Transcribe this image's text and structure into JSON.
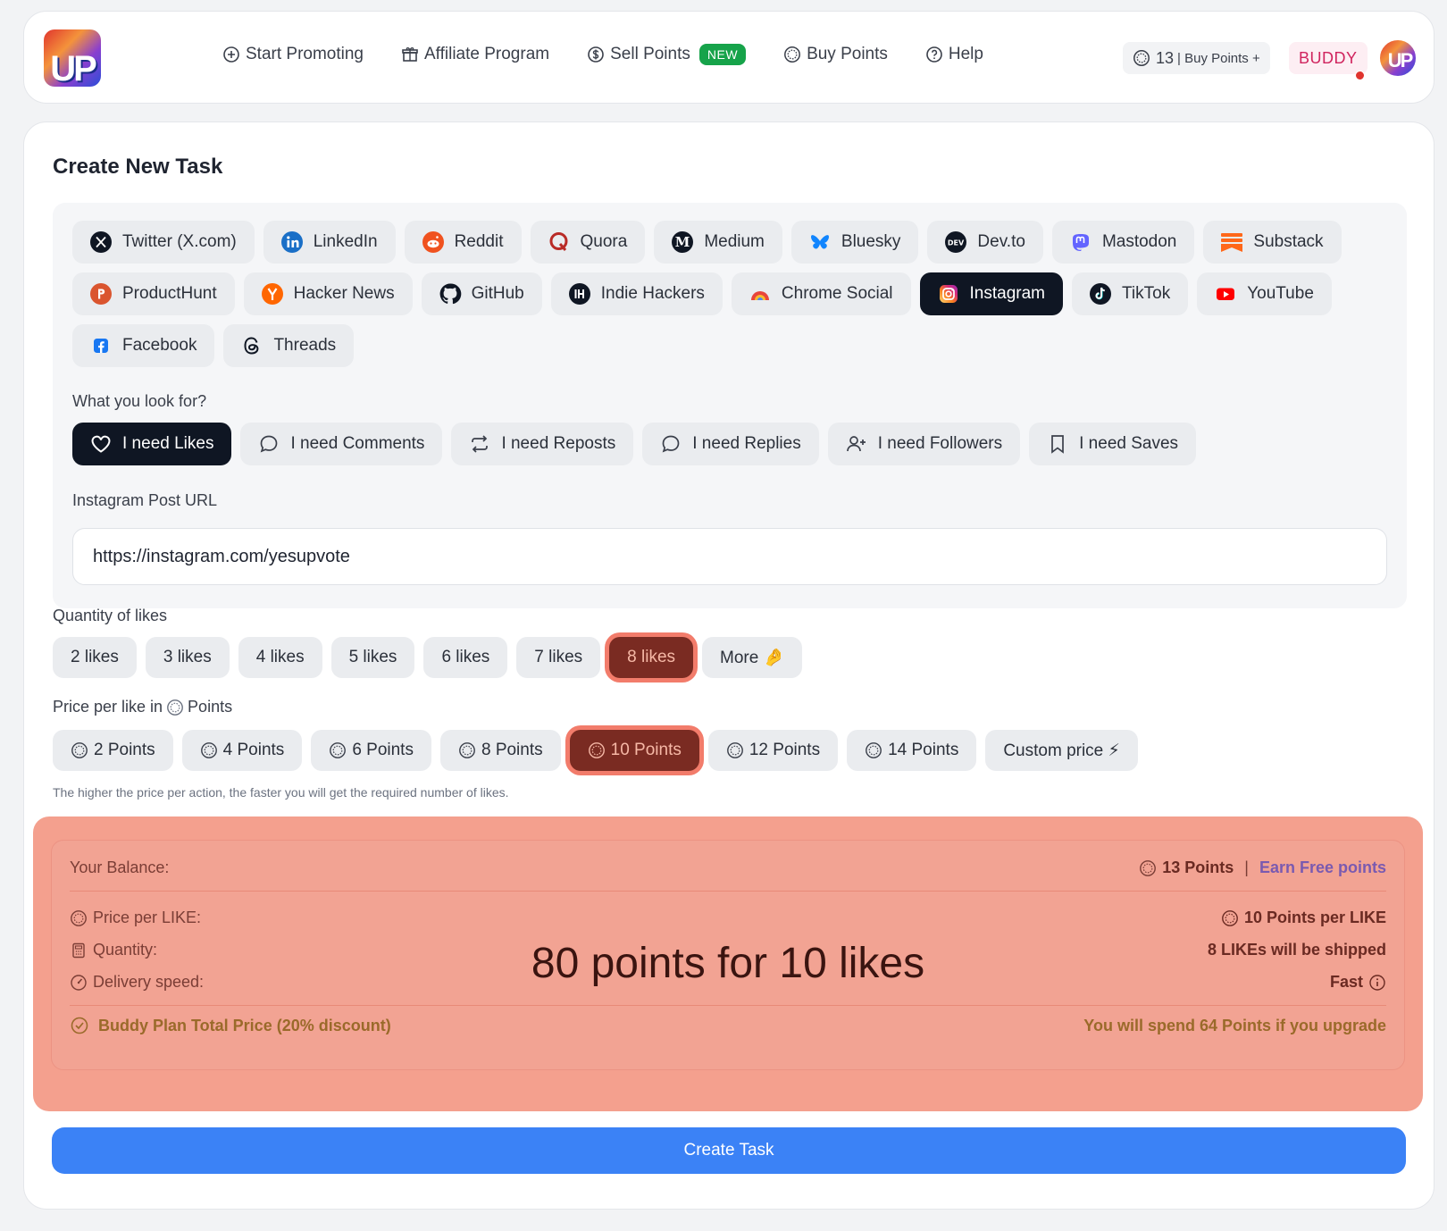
{
  "header": {
    "logo_text": "UP",
    "nav": [
      {
        "label": "Start Promoting",
        "icon": "plus-circle-icon"
      },
      {
        "label": "Affiliate Program",
        "icon": "gift-icon"
      },
      {
        "label": "Sell Points",
        "icon": "dollar-circle-icon",
        "badge": "NEW"
      },
      {
        "label": "Buy Points",
        "icon": "points-coin-icon"
      },
      {
        "label": "Help",
        "icon": "help-circle-icon"
      }
    ],
    "balance_count": "13",
    "balance_link": "| Buy Points +",
    "plan": "BUDDY"
  },
  "card": {
    "title": "Create New Task"
  },
  "platforms": [
    {
      "label": "Twitter (X.com)",
      "icon": "x-logo-icon"
    },
    {
      "label": "LinkedIn",
      "icon": "linkedin-icon"
    },
    {
      "label": "Reddit",
      "icon": "reddit-icon"
    },
    {
      "label": "Quora",
      "icon": "quora-icon"
    },
    {
      "label": "Medium",
      "icon": "medium-icon"
    },
    {
      "label": "Bluesky",
      "icon": "bluesky-icon"
    },
    {
      "label": "Dev.to",
      "icon": "devto-icon"
    },
    {
      "label": "Mastodon",
      "icon": "mastodon-icon"
    },
    {
      "label": "Substack",
      "icon": "substack-icon"
    },
    {
      "label": "ProductHunt",
      "icon": "producthunt-icon"
    },
    {
      "label": "Hacker News",
      "icon": "hackernews-icon"
    },
    {
      "label": "GitHub",
      "icon": "github-icon"
    },
    {
      "label": "Indie Hackers",
      "icon": "indiehackers-icon"
    },
    {
      "label": "Chrome Social",
      "icon": "chrome-icon"
    },
    {
      "label": "Instagram",
      "icon": "instagram-icon",
      "active": true
    },
    {
      "label": "TikTok",
      "icon": "tiktok-icon"
    },
    {
      "label": "YouTube",
      "icon": "youtube-icon"
    },
    {
      "label": "Facebook",
      "icon": "facebook-icon"
    },
    {
      "label": "Threads",
      "icon": "threads-icon"
    }
  ],
  "look_for": {
    "label": "What you look for?",
    "options": [
      {
        "label": "I need Likes",
        "icon": "heart-icon",
        "active": true
      },
      {
        "label": "I need Comments",
        "icon": "comment-icon"
      },
      {
        "label": "I need Reposts",
        "icon": "repost-icon"
      },
      {
        "label": "I need Replies",
        "icon": "reply-icon"
      },
      {
        "label": "I need Followers",
        "icon": "user-plus-icon"
      },
      {
        "label": "I need Saves",
        "icon": "bookmark-icon"
      }
    ]
  },
  "url_field": {
    "label": "Instagram Post URL",
    "value": "https://instagram.com/yesupvote"
  },
  "quantity": {
    "label": "Quantity of likes",
    "options": [
      "2 likes",
      "3 likes",
      "4 likes",
      "5 likes",
      "6 likes",
      "7 likes",
      "8 likes",
      "More 🤌"
    ],
    "selected": "8 likes"
  },
  "price": {
    "label_prefix": "Price per like in",
    "label_suffix": "Points",
    "options": [
      "2 Points",
      "4 Points",
      "6 Points",
      "8 Points",
      "10 Points",
      "12 Points",
      "14 Points",
      "Custom price ⚡"
    ],
    "selected": "10 Points",
    "hint": "The higher the price per action, the faster you will get the required number of likes."
  },
  "summary": {
    "balance_label": "Your Balance:",
    "balance_value": "13 Points",
    "separator": "|",
    "earn_link": "Earn Free points",
    "rows": [
      {
        "label": "Price per LIKE:",
        "value": "10 Points per LIKE",
        "icon": "points-coin-icon"
      },
      {
        "label": "Quantity:",
        "value": "8 LIKEs will be shipped",
        "icon": "calculator-icon"
      },
      {
        "label": "Delivery speed:",
        "value": "Fast",
        "icon": "speed-icon"
      }
    ],
    "total": "80 points for 10 likes",
    "buddy_label": "Buddy Plan Total Price (20% discount)",
    "buddy_value": "You will spend 64 Points if you upgrade"
  },
  "cta": {
    "label": "Create Task"
  }
}
